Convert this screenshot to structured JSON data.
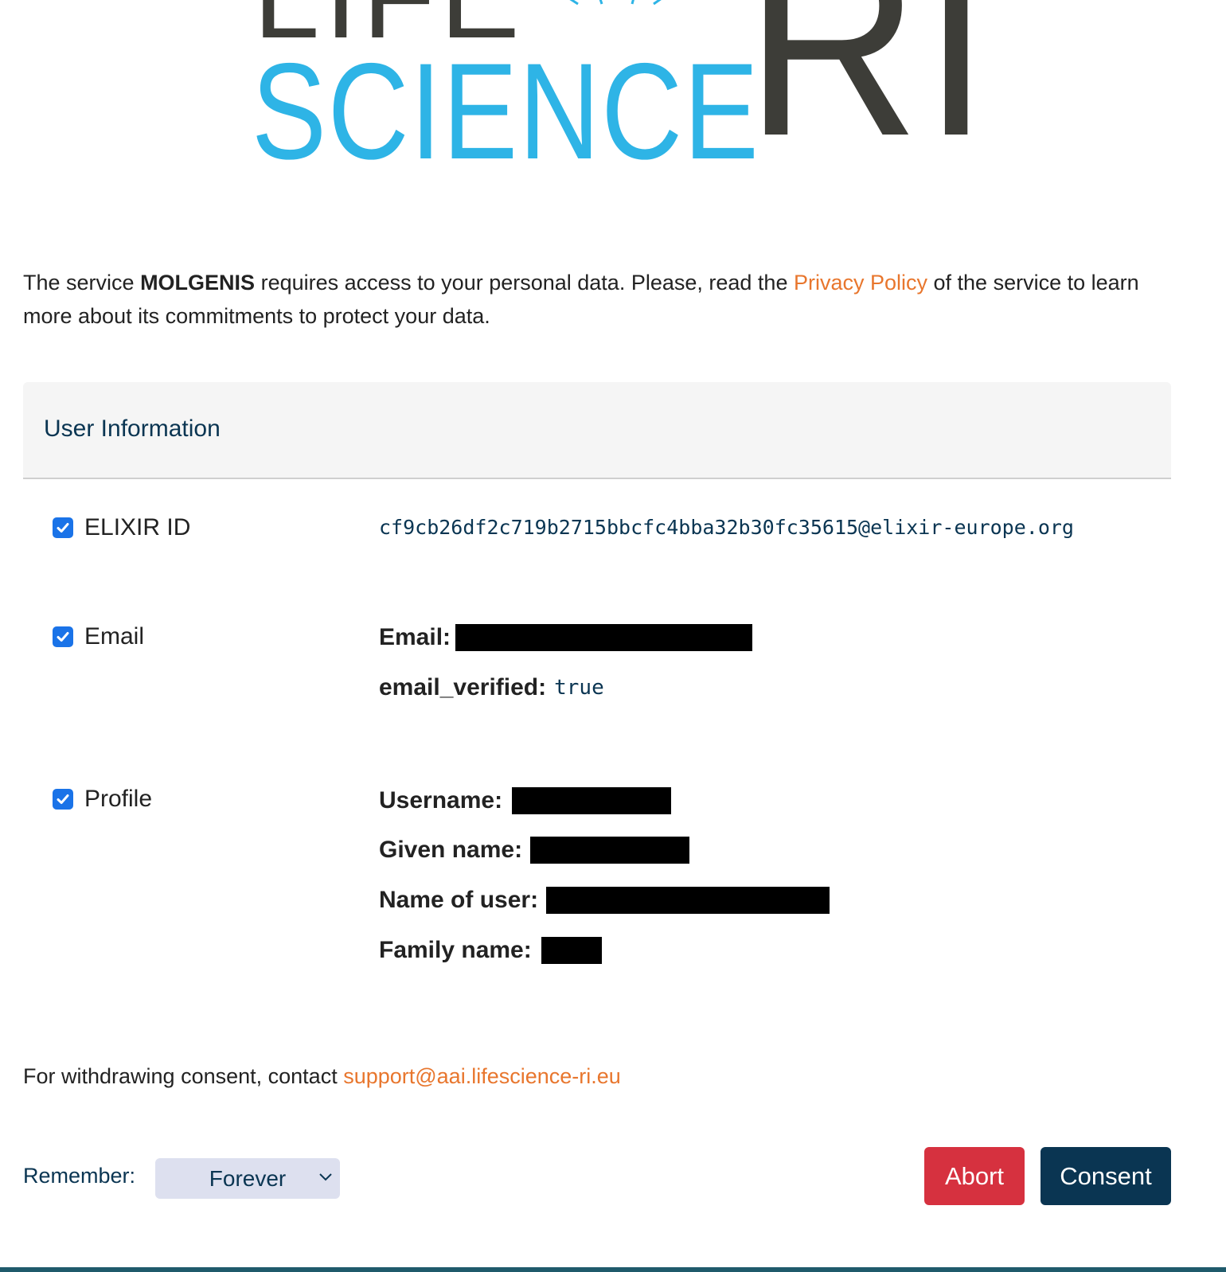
{
  "logo": {
    "word_life": "LIFE",
    "word_science": "SCIENCE",
    "word_ri": "RI"
  },
  "intro": {
    "prefix": "The service ",
    "service_name": "MOLGENIS",
    "middle": " requires access to your personal data. Please, read the ",
    "privacy_link": "Privacy Policy",
    "suffix": " of the service to learn more about its commitments to protect your data."
  },
  "card": {
    "title": "User Information"
  },
  "scopes": {
    "elixir": {
      "label": "ELIXIR ID",
      "checked": true,
      "value": "cf9cb26df2c719b2715bbcfc4bba32b30fc35615@elixir-europe.org"
    },
    "email": {
      "label": "Email",
      "checked": true,
      "email_key": "Email:",
      "verified_key": "email_verified:",
      "verified_value": "true"
    },
    "profile": {
      "label": "Profile",
      "checked": true,
      "username_key": "Username:",
      "given_name_key": "Given name:",
      "name_of_user_key": "Name of user:",
      "family_name_key": "Family name:"
    }
  },
  "footer": {
    "withdraw_text": "For withdrawing consent, contact ",
    "support_email": "support@aai.lifescience-ri.eu",
    "remember_label": "Remember:",
    "remember_value": "Forever",
    "abort_label": "Abort",
    "consent_label": "Consent"
  },
  "colors": {
    "link": "#e8762d",
    "primary": "#0a3552",
    "danger": "#d6313f",
    "checkbox": "#1a73e8",
    "logo_blue": "#2eb4e6",
    "logo_dark": "#3d3d38"
  }
}
